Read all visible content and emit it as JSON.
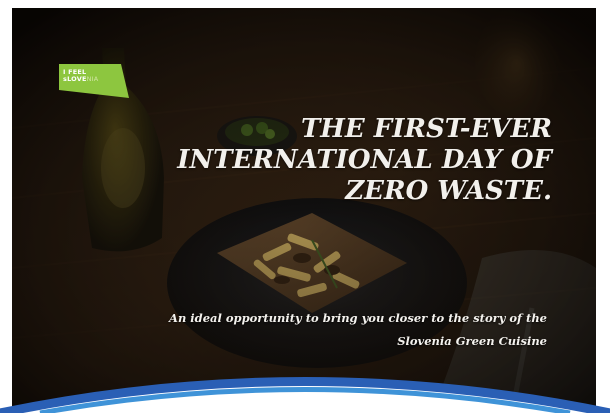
{
  "logo": {
    "line1": "I FEEL",
    "line2_a": "sLOVE",
    "line2_b": "NIA",
    "color": "#8dc63f"
  },
  "headline": {
    "line1": "THE FIRST-EVER",
    "line2": "INTERNATIONAL DAY OF",
    "line3": "ZERO WASTE."
  },
  "subtitle": {
    "line1": "An ideal opportunity to bring you closer to the story of the",
    "line2": "Slovenia Green Cuisine"
  },
  "colors": {
    "background": "#120d08",
    "text": "#f2f0ec",
    "arc_outer": "#2a5fb5",
    "arc_inner": "#3f93d8"
  }
}
